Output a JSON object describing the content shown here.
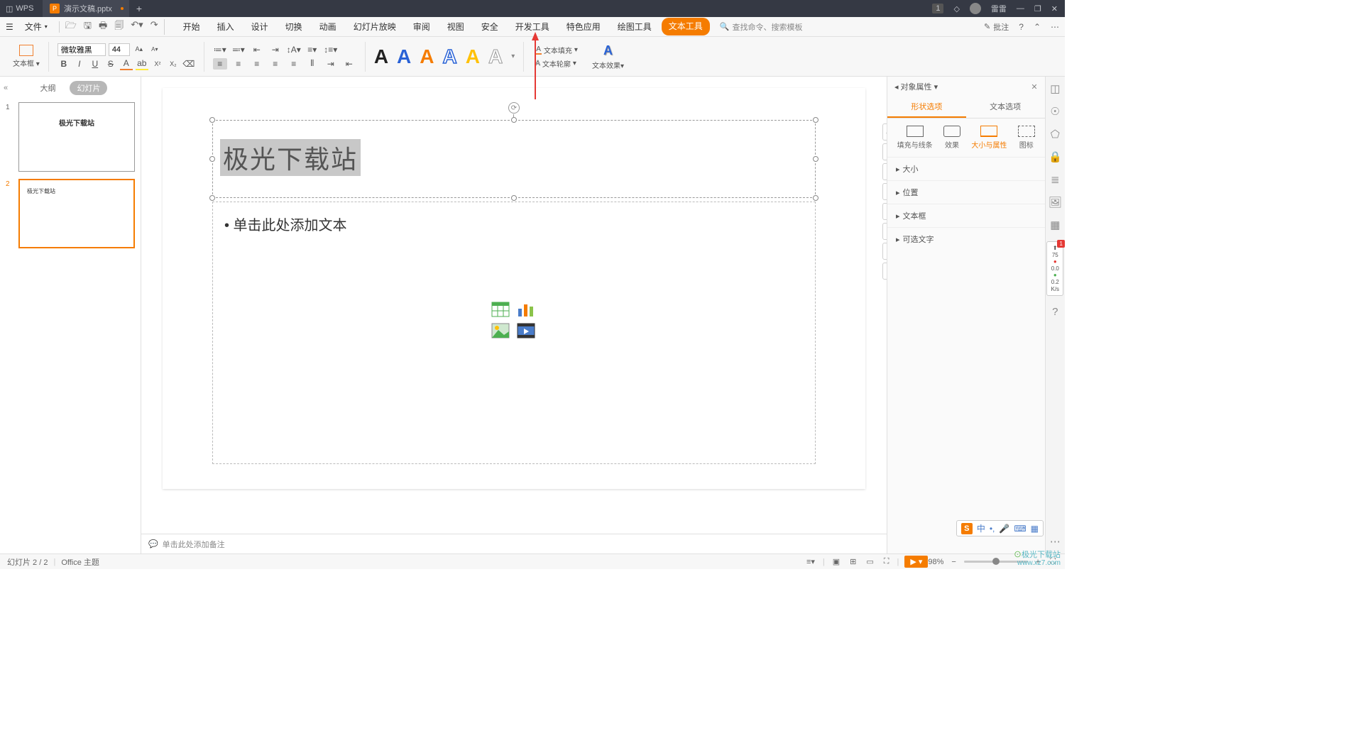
{
  "titlebar": {
    "app": "WPS",
    "doc": "演示文稿.pptx",
    "user": "雷雷",
    "notif_count": "1"
  },
  "menubar": {
    "file": "文件",
    "tabs": [
      "开始",
      "插入",
      "设计",
      "切换",
      "动画",
      "幻灯片放映",
      "审阅",
      "视图",
      "安全",
      "开发工具",
      "特色应用",
      "绘图工具",
      "文本工具"
    ],
    "active_tab": "文本工具",
    "search_placeholder": "查找命令、搜索模板",
    "review_btn": "批注"
  },
  "ribbon": {
    "textbox_label": "文本框",
    "font_name": "微软雅黑",
    "font_size": "44",
    "text_fill": "文本填充",
    "text_outline": "文本轮廓",
    "text_effect": "文本效果",
    "wordart_letter": "A"
  },
  "slide_panel": {
    "tabs": {
      "outline": "大纲",
      "slides": "幻灯片"
    },
    "slides": [
      {
        "num": "1",
        "title": "极光下载站"
      },
      {
        "num": "2",
        "title": "极光下载站"
      }
    ]
  },
  "canvas": {
    "title_text": "极光下载站",
    "content_placeholder": "单击此处添加文本"
  },
  "notes_placeholder": "单击此处添加备注",
  "props": {
    "title": "对象属性",
    "tabs": {
      "shape": "形状选项",
      "text": "文本选项"
    },
    "subtabs": {
      "fill": "填充与线条",
      "effect": "效果",
      "size": "大小与属性",
      "icon": "图标"
    },
    "sections": {
      "size": "大小",
      "position": "位置",
      "textbox": "文本框",
      "alt": "可选文字"
    }
  },
  "perf": {
    "val1": "75",
    "val2": "0.0",
    "val3": "0.2",
    "unit": "K/s"
  },
  "statusbar": {
    "slide_info": "幻灯片 2 / 2",
    "theme": "Office 主题",
    "zoom": "98%"
  },
  "ime": {
    "lang": "中"
  },
  "watermark": {
    "line1": "极光下载站",
    "line2": "www.xz7.com"
  }
}
